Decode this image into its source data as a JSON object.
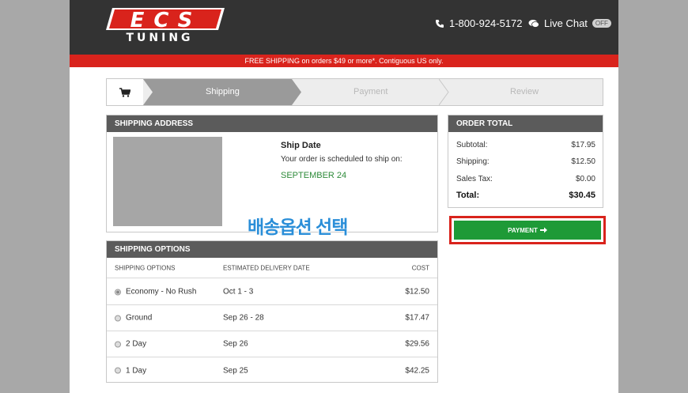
{
  "brand": {
    "logo_top": "ECS",
    "logo_bottom": "TUNING"
  },
  "header": {
    "phone": "1-800-924-5172",
    "chat_label": "Live Chat",
    "chat_status": "OFF"
  },
  "promo": "FREE SHIPPING on orders $49 or more*. Contiguous US only.",
  "steps": [
    {
      "label": "Shipping",
      "active": true
    },
    {
      "label": "Payment",
      "active": false
    },
    {
      "label": "Review",
      "active": false
    }
  ],
  "shipping_address": {
    "heading": "SHIPPING ADDRESS",
    "ship_date_title": "Ship Date",
    "ship_date_text": "Your order is scheduled to ship on:",
    "ship_date_value": "SEPTEMBER 24"
  },
  "annotation": "배송옵션 선택",
  "order_total": {
    "heading": "ORDER TOTAL",
    "rows": [
      {
        "label": "Subtotal:",
        "value": "$17.95"
      },
      {
        "label": "Shipping:",
        "value": "$12.50"
      },
      {
        "label": "Sales Tax:",
        "value": "$0.00"
      }
    ],
    "total_label": "Total:",
    "total_value": "$30.45"
  },
  "payment_button": "PAYMENT",
  "shipping_options": {
    "heading": "SHIPPING OPTIONS",
    "columns": [
      "SHIPPING OPTIONS",
      "ESTIMATED DELIVERY DATE",
      "COST"
    ],
    "rows": [
      {
        "name": "Economy - No Rush",
        "date": "Oct 1 - 3",
        "cost": "$12.50",
        "selected": true
      },
      {
        "name": "Ground",
        "date": "Sep 26 - 28",
        "cost": "$17.47",
        "selected": false
      },
      {
        "name": "2 Day",
        "date": "Sep 26",
        "cost": "$29.56",
        "selected": false
      },
      {
        "name": "1 Day",
        "date": "Sep 25",
        "cost": "$42.25",
        "selected": false
      }
    ]
  },
  "colors": {
    "header": "#333333",
    "promo": "#d9231c",
    "accent_green": "#1e9a37",
    "date_green": "#2e8b3a"
  }
}
